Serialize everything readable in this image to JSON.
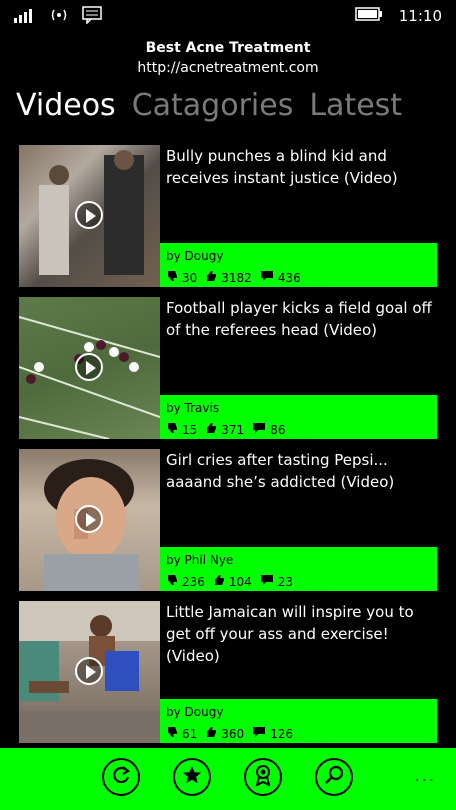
{
  "status_bar": {
    "time": "11:10"
  },
  "header": {
    "title": "Best Acne Treatment",
    "url": "http://acnetreatment.com"
  },
  "tabs": [
    {
      "label": "Videos"
    },
    {
      "label": "Catagories"
    },
    {
      "label": "Latest"
    }
  ],
  "videos": [
    {
      "title": "Bully punches a blind kid and receives instant justice (Video)",
      "author": "by Dougy",
      "dislikes": "30",
      "likes": "3182",
      "comments": "436"
    },
    {
      "title": "Football player kicks a field goal off of the referees head (Video)",
      "author": "by Travis",
      "dislikes": "15",
      "likes": "371",
      "comments": "86"
    },
    {
      "title": "Girl cries after tasting Pepsi... aaaand she’s addicted (Video)",
      "author": "by Phil Nye",
      "dislikes": "236",
      "likes": "104",
      "comments": "23"
    },
    {
      "title": "Little Jamaican will inspire you to get off your ass and exercise! (Video)",
      "author": "by Dougy",
      "dislikes": "61",
      "likes": "360",
      "comments": "126"
    }
  ],
  "colors": {
    "accent": "#00ff00",
    "background": "#000000"
  },
  "app_bar": {
    "buttons": [
      "refresh-icon",
      "star-icon",
      "badge-icon",
      "search-icon"
    ],
    "more": "..."
  }
}
